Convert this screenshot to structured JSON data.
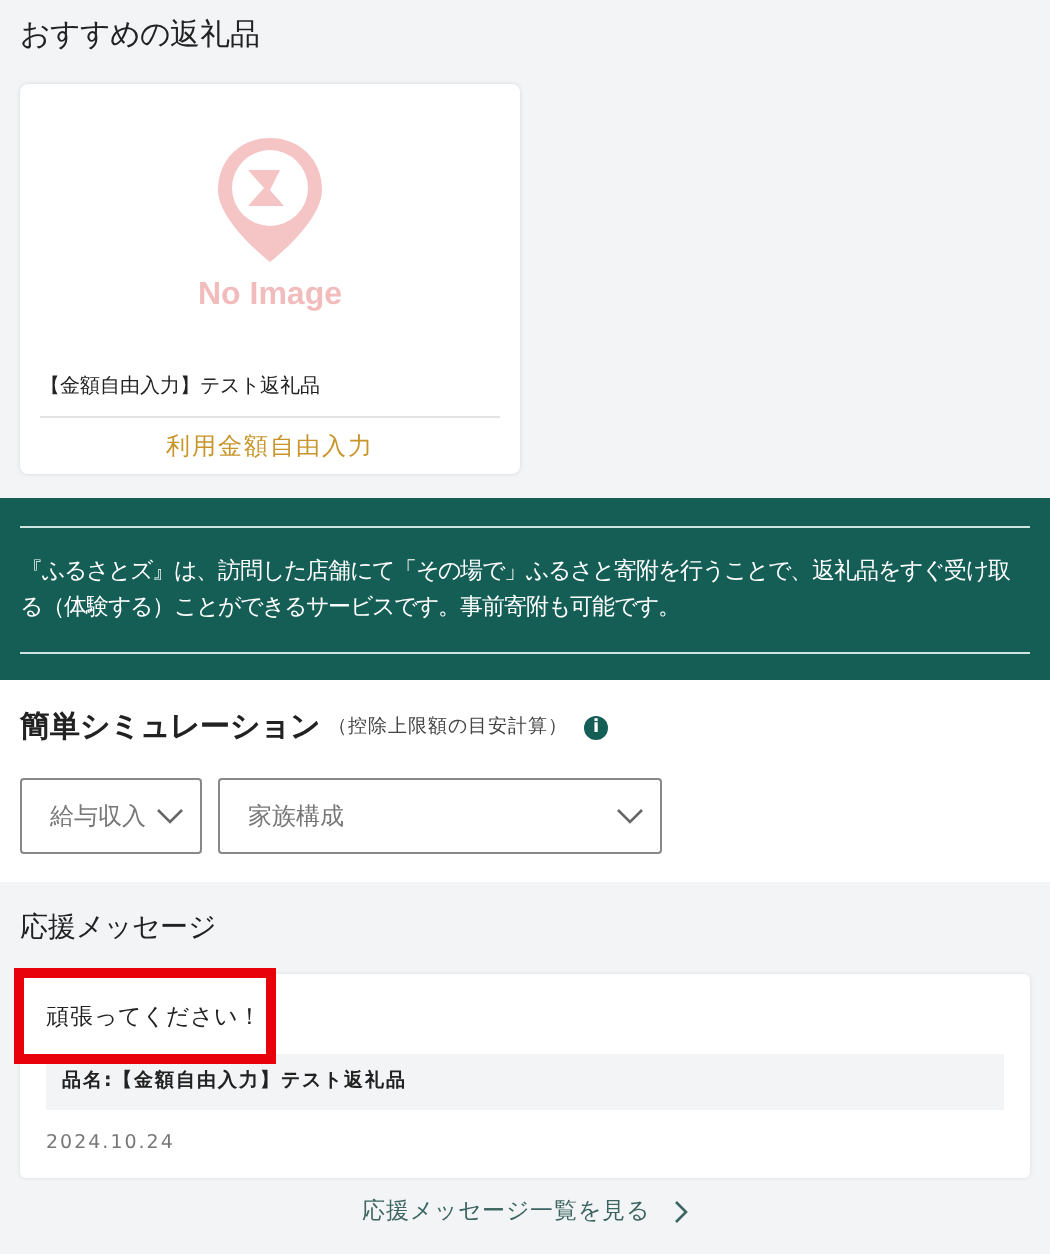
{
  "recommended": {
    "heading": "おすすめの返礼品",
    "items": [
      {
        "image": {
          "kind": "no_image",
          "caption": "No Image"
        },
        "name": "【金額自由入力】テスト返礼品",
        "price": "利用金額自由入力"
      }
    ]
  },
  "banner": {
    "text": "『ふるさとズ』は、訪問した店舗にて「その場で」ふるさと寄附を行うことで、返礼品をすぐ受け取る（体験する）ことができるサービスです。事前寄附も可能です。"
  },
  "simulation": {
    "heading": "簡単シミュレーション",
    "subheading": "（控除上限額の目安計算）",
    "info_icon": "i",
    "selects": [
      {
        "placeholder": "給与収入"
      },
      {
        "placeholder": "家族構成"
      }
    ]
  },
  "messages": {
    "heading": "応援メッセージ",
    "items": [
      {
        "text": "頑張ってください！",
        "highlighted": true,
        "item": "品名:【金額自由入力】テスト返礼品",
        "date": "2024.10.24"
      }
    ],
    "more_link": "応援メッセージ一覧を見る"
  }
}
